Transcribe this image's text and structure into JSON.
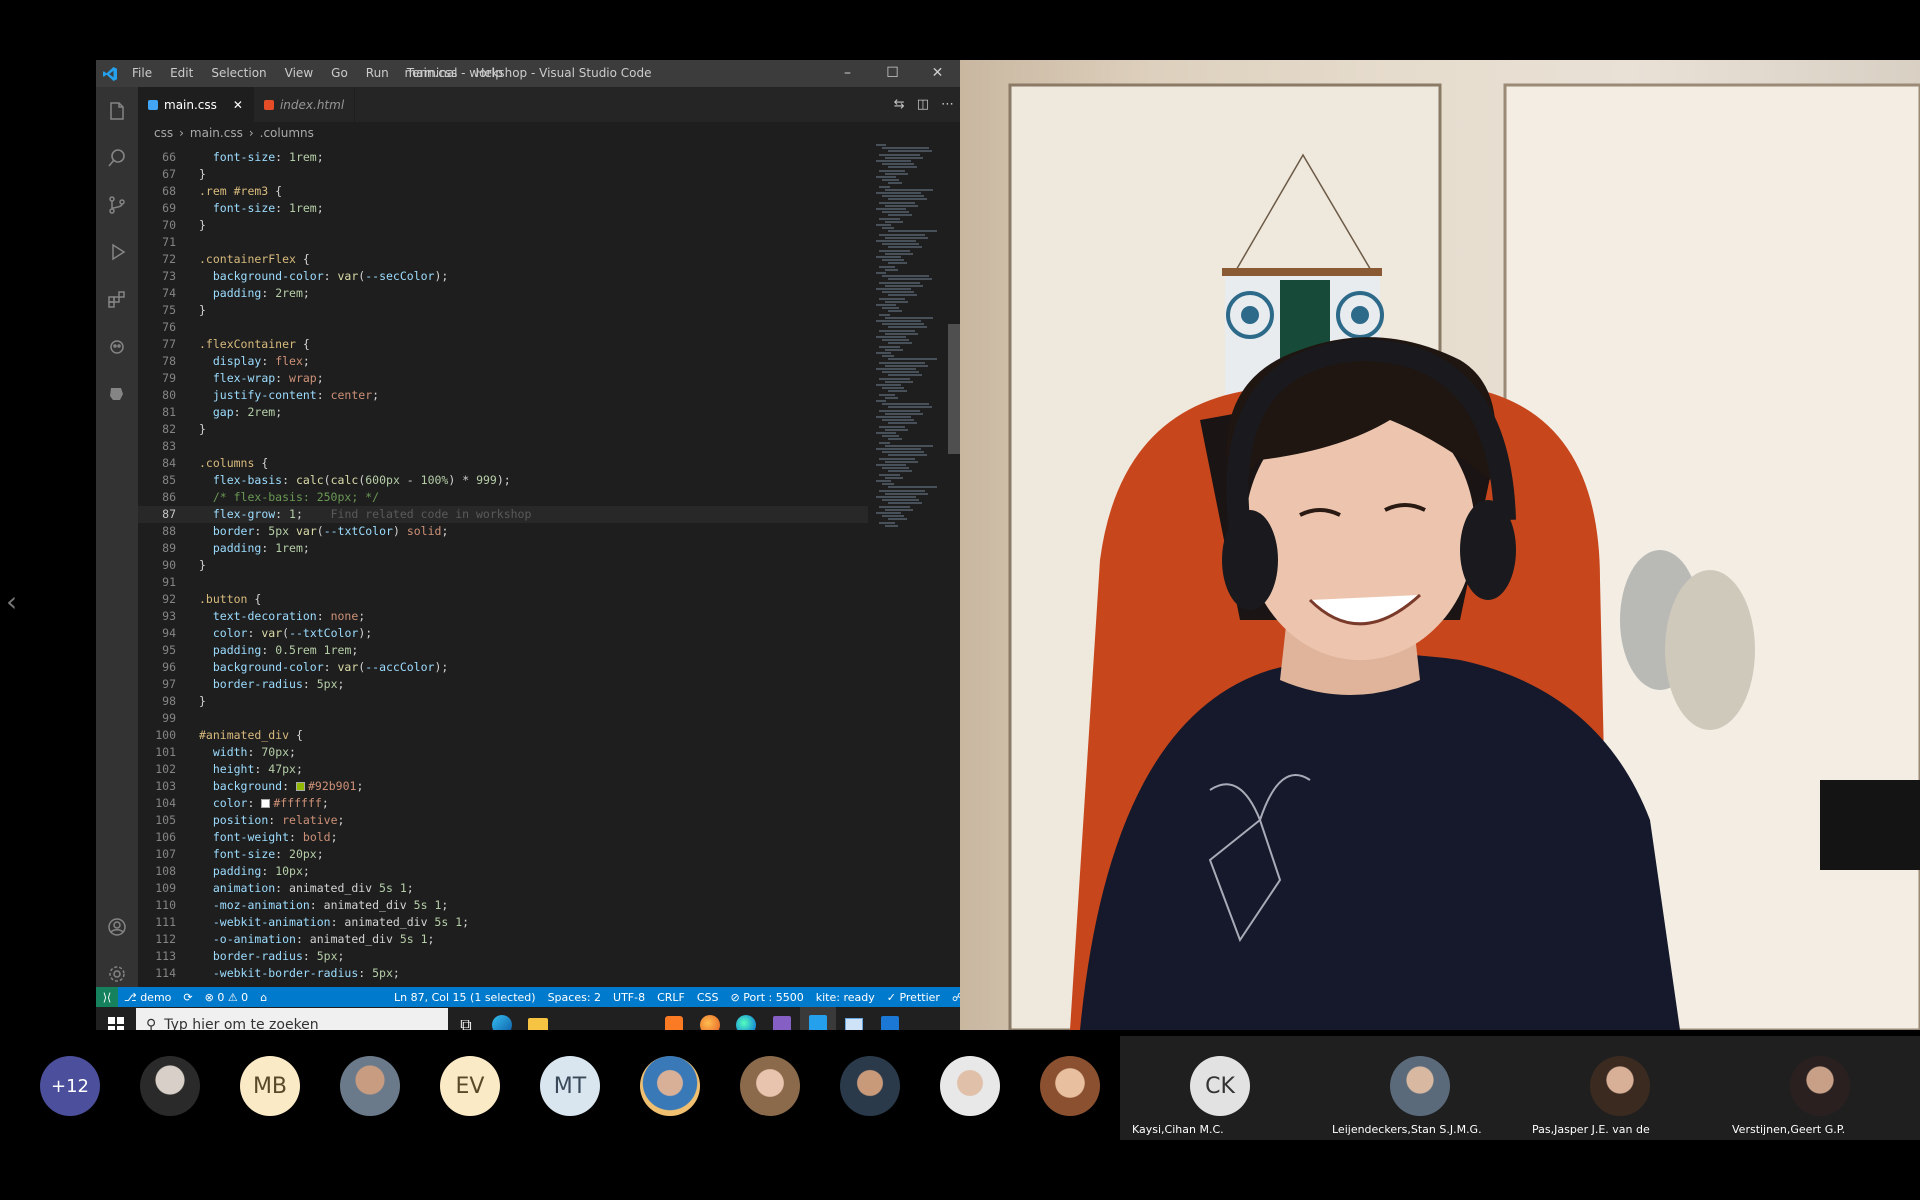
{
  "vscode": {
    "menu": [
      "File",
      "Edit",
      "Selection",
      "View",
      "Go",
      "Run",
      "Terminal",
      "Help"
    ],
    "window_title": "main.css - workshop - Visual Studio Code",
    "tabs": [
      {
        "label": "main.css",
        "active": true
      },
      {
        "label": "index.html",
        "active": false
      }
    ],
    "breadcrumb": [
      "css",
      "main.css",
      ".columns"
    ],
    "code": [
      {
        "n": "66",
        "html": "  <span class='t-prop'>font-size</span><span class='t-pun'>: </span><span class='t-num'>1rem</span><span class='t-pun'>;</span>"
      },
      {
        "n": "67",
        "html": "<span class='t-pun'>}</span>"
      },
      {
        "n": "68",
        "html": "<span class='t-sel'>.rem #rem3</span><span class='t-pun'> {</span>"
      },
      {
        "n": "69",
        "html": "  <span class='t-prop'>font-size</span><span class='t-pun'>: </span><span class='t-num'>1rem</span><span class='t-pun'>;</span>"
      },
      {
        "n": "70",
        "html": "<span class='t-pun'>}</span>"
      },
      {
        "n": "71",
        "html": ""
      },
      {
        "n": "72",
        "html": "<span class='t-sel'>.containerFlex</span><span class='t-pun'> {</span>"
      },
      {
        "n": "73",
        "html": "  <span class='t-prop'>background-color</span><span class='t-pun'>: </span><span class='t-fn'>var</span><span class='t-pun'>(</span><span class='t-prop'>--secColor</span><span class='t-pun'>);</span>"
      },
      {
        "n": "74",
        "html": "  <span class='t-prop'>padding</span><span class='t-pun'>: </span><span class='t-num'>2rem</span><span class='t-pun'>;</span>"
      },
      {
        "n": "75",
        "html": "<span class='t-pun'>}</span>"
      },
      {
        "n": "76",
        "html": ""
      },
      {
        "n": "77",
        "html": "<span class='t-sel'>.flexContainer</span><span class='t-pun'> {</span>"
      },
      {
        "n": "78",
        "html": "  <span class='t-prop'>display</span><span class='t-pun'>: </span><span class='t-val'>flex</span><span class='t-pun'>;</span>"
      },
      {
        "n": "79",
        "html": "  <span class='t-prop'>flex-wrap</span><span class='t-pun'>: </span><span class='t-val'>wrap</span><span class='t-pun'>;</span>"
      },
      {
        "n": "80",
        "html": "  <span class='t-prop'>justify-content</span><span class='t-pun'>: </span><span class='t-val'>center</span><span class='t-pun'>;</span>"
      },
      {
        "n": "81",
        "html": "  <span class='t-prop'>gap</span><span class='t-pun'>: </span><span class='t-num'>2rem</span><span class='t-pun'>;</span>"
      },
      {
        "n": "82",
        "html": "<span class='t-pun'>}</span>"
      },
      {
        "n": "83",
        "html": ""
      },
      {
        "n": "84",
        "html": "<span class='t-sel'>.columns</span><span class='t-pun'> {</span>"
      },
      {
        "n": "85",
        "html": "  <span class='t-prop'>flex-basis</span><span class='t-pun'>: </span><span class='t-fn'>calc</span><span class='t-pun'>(</span><span class='t-fn'>calc</span><span class='t-pun'>(</span><span class='t-num'>600px</span><span class='t-pun'> - </span><span class='t-num'>100%</span><span class='t-pun'>) * </span><span class='t-num'>999</span><span class='t-pun'>);</span>"
      },
      {
        "n": "86",
        "html": "  <span class='t-cm'>/* flex-basis: 250px; */</span>"
      },
      {
        "n": "87",
        "html": "  <span class='t-prop'>flex-grow</span><span class='t-pun'>: </span><span class='t-num'>1</span><span class='t-pun'>;</span>    <span class='t-hint'>Find related code in workshop</span>",
        "current": true
      },
      {
        "n": "88",
        "html": "  <span class='t-prop'>border</span><span class='t-pun'>: </span><span class='t-num'>5px</span><span class='t-pun'> </span><span class='t-fn'>var</span><span class='t-pun'>(</span><span class='t-prop'>--txtColor</span><span class='t-pun'>) </span><span class='t-val'>solid</span><span class='t-pun'>;</span>"
      },
      {
        "n": "89",
        "html": "  <span class='t-prop'>padding</span><span class='t-pun'>: </span><span class='t-num'>1rem</span><span class='t-pun'>;</span>"
      },
      {
        "n": "90",
        "html": "<span class='t-pun'>}</span>"
      },
      {
        "n": "91",
        "html": ""
      },
      {
        "n": "92",
        "html": "<span class='t-sel'>.button</span><span class='t-pun'> {</span>"
      },
      {
        "n": "93",
        "html": "  <span class='t-prop'>text-decoration</span><span class='t-pun'>: </span><span class='t-val'>none</span><span class='t-pun'>;</span>"
      },
      {
        "n": "94",
        "html": "  <span class='t-prop'>color</span><span class='t-pun'>: </span><span class='t-fn'>var</span><span class='t-pun'>(</span><span class='t-prop'>--txtColor</span><span class='t-pun'>);</span>"
      },
      {
        "n": "95",
        "html": "  <span class='t-prop'>padding</span><span class='t-pun'>: </span><span class='t-num'>0.5rem</span><span class='t-pun'> </span><span class='t-num'>1rem</span><span class='t-pun'>;</span>"
      },
      {
        "n": "96",
        "html": "  <span class='t-prop'>background-color</span><span class='t-pun'>: </span><span class='t-fn'>var</span><span class='t-pun'>(</span><span class='t-prop'>--accColor</span><span class='t-pun'>);</span>"
      },
      {
        "n": "97",
        "html": "  <span class='t-prop'>border-radius</span><span class='t-pun'>: </span><span class='t-num'>5px</span><span class='t-pun'>;</span>"
      },
      {
        "n": "98",
        "html": "<span class='t-pun'>}</span>"
      },
      {
        "n": "99",
        "html": ""
      },
      {
        "n": "100",
        "html": "<span class='t-sel'>#animated_div</span><span class='t-pun'> {</span>"
      },
      {
        "n": "101",
        "html": "  <span class='t-prop'>width</span><span class='t-pun'>: </span><span class='t-num'>70px</span><span class='t-pun'>;</span>"
      },
      {
        "n": "102",
        "html": "  <span class='t-prop'>height</span><span class='t-pun'>: </span><span class='t-num'>47px</span><span class='t-pun'>;</span>"
      },
      {
        "n": "103",
        "html": "  <span class='t-prop'>background</span><span class='t-pun'>: </span><span class='swatch' style='background:#92b901'></span><span class='t-val'>#92b901</span><span class='t-pun'>;</span>"
      },
      {
        "n": "104",
        "html": "  <span class='t-prop'>color</span><span class='t-pun'>: </span><span class='swatch' style='background:#ffffff'></span><span class='t-val'>#ffffff</span><span class='t-pun'>;</span>"
      },
      {
        "n": "105",
        "html": "  <span class='t-prop'>position</span><span class='t-pun'>: </span><span class='t-val'>relative</span><span class='t-pun'>;</span>"
      },
      {
        "n": "106",
        "html": "  <span class='t-prop'>font-weight</span><span class='t-pun'>: </span><span class='t-val'>bold</span><span class='t-pun'>;</span>"
      },
      {
        "n": "107",
        "html": "  <span class='t-prop'>font-size</span><span class='t-pun'>: </span><span class='t-num'>20px</span><span class='t-pun'>;</span>"
      },
      {
        "n": "108",
        "html": "  <span class='t-prop'>padding</span><span class='t-pun'>: </span><span class='t-num'>10px</span><span class='t-pun'>;</span>"
      },
      {
        "n": "109",
        "html": "  <span class='t-prop'>animation</span><span class='t-pun'>: animated_div </span><span class='t-num'>5s</span><span class='t-pun'> </span><span class='t-num'>1</span><span class='t-pun'>;</span>"
      },
      {
        "n": "110",
        "html": "  <span class='t-prop'>-moz-animation</span><span class='t-pun'>: animated_div </span><span class='t-num'>5s</span><span class='t-pun'> </span><span class='t-num'>1</span><span class='t-pun'>;</span>"
      },
      {
        "n": "111",
        "html": "  <span class='t-prop'>-webkit-animation</span><span class='t-pun'>: animated_div </span><span class='t-num'>5s</span><span class='t-pun'> </span><span class='t-num'>1</span><span class='t-pun'>;</span>"
      },
      {
        "n": "112",
        "html": "  <span class='t-prop'>-o-animation</span><span class='t-pun'>: animated_div </span><span class='t-num'>5s</span><span class='t-pun'> </span><span class='t-num'>1</span><span class='t-pun'>;</span>"
      },
      {
        "n": "113",
        "html": "  <span class='t-prop'>border-radius</span><span class='t-pun'>: </span><span class='t-num'>5px</span><span class='t-pun'>;</span>"
      },
      {
        "n": "114",
        "html": "  <span class='t-prop'>-webkit-border-radius</span><span class='t-pun'>: </span><span class='t-num'>5px</span><span class='t-pun'>;</span>"
      }
    ],
    "status": {
      "branch": "demo",
      "problems": "⊗ 0 ⚠ 0",
      "position": "Ln 87, Col 15 (1 selected)",
      "spaces": "Spaces: 2",
      "encoding": "UTF-8",
      "eol": "CRLF",
      "language": "CSS",
      "port": "⊘ Port : 5500",
      "kite": "kite: ready",
      "prettier": "✓ Prettier"
    },
    "taskbar_search_placeholder": "Typ hier om te zoeken"
  },
  "participants": {
    "overflow": "+12",
    "initials": [
      "MB",
      "EV",
      "MT"
    ],
    "named": [
      {
        "name": "Kaysi,Cihan M.C.",
        "initials": "CK"
      },
      {
        "name": "Leijendeckers,Stan S.J.M.G."
      },
      {
        "name": "Pas,Jasper J.E. van de"
      },
      {
        "name": "Verstijnen,Geert G.P."
      }
    ]
  }
}
